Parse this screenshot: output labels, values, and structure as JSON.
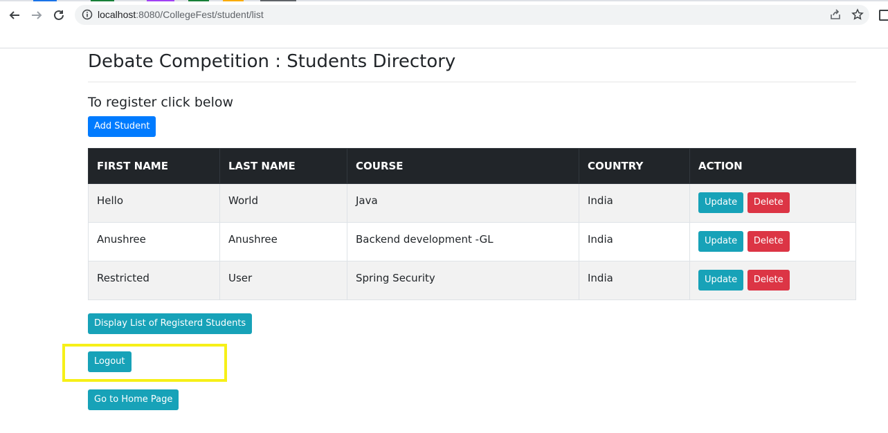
{
  "browser": {
    "url_host": "localhost",
    "url_rest": ":8080/CollegeFest/student/list"
  },
  "page": {
    "title": "Debate Competition : Students Directory",
    "subtitle": "To register click below",
    "add_button": "Add Student"
  },
  "table": {
    "headers": [
      "FIRST NAME",
      "LAST NAME",
      "COURSE",
      "COUNTRY",
      "ACTION"
    ],
    "rows": [
      {
        "first": "Hello",
        "last": "World",
        "course": "Java",
        "country": "India"
      },
      {
        "first": "Anushree",
        "last": "Anushree",
        "course": "Backend development -GL",
        "country": "India"
      },
      {
        "first": "Restricted",
        "last": "User",
        "course": "Spring Security",
        "country": "India"
      }
    ],
    "update_label": "Update",
    "delete_label": "Delete"
  },
  "footer_buttons": {
    "display": "Display List of Registerd Students",
    "logout": "Logout",
    "home": "Go to Home Page"
  },
  "colors": {
    "primary": "#007bff",
    "info": "#17a2b8",
    "danger": "#dc3545",
    "table_header": "#212529",
    "highlight": "#f6f018"
  }
}
